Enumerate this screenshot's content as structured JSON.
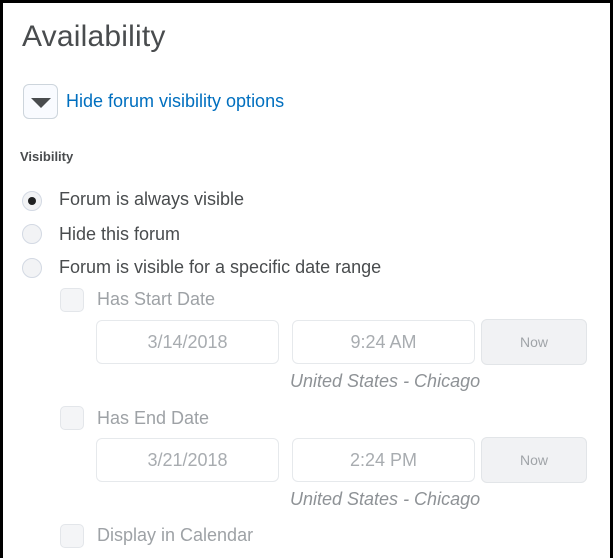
{
  "section": {
    "title": "Availability"
  },
  "toggle": {
    "label": "Hide forum visibility options",
    "icon": "caret-down-icon"
  },
  "visibility": {
    "label": "Visibility",
    "options": [
      {
        "label": "Forum is always visible",
        "checked": true
      },
      {
        "label": "Hide this forum",
        "checked": false
      },
      {
        "label": "Forum is visible for a specific date range",
        "checked": false
      }
    ]
  },
  "start": {
    "checkbox_label": "Has Start Date",
    "date": "3/14/2018",
    "time": "9:24 AM",
    "now_label": "Now",
    "timezone": "United States - Chicago"
  },
  "end": {
    "checkbox_label": "Has End Date",
    "date": "3/21/2018",
    "time": "2:24 PM",
    "now_label": "Now",
    "timezone": "United States - Chicago"
  },
  "calendar": {
    "checkbox_label": "Display in Calendar"
  }
}
